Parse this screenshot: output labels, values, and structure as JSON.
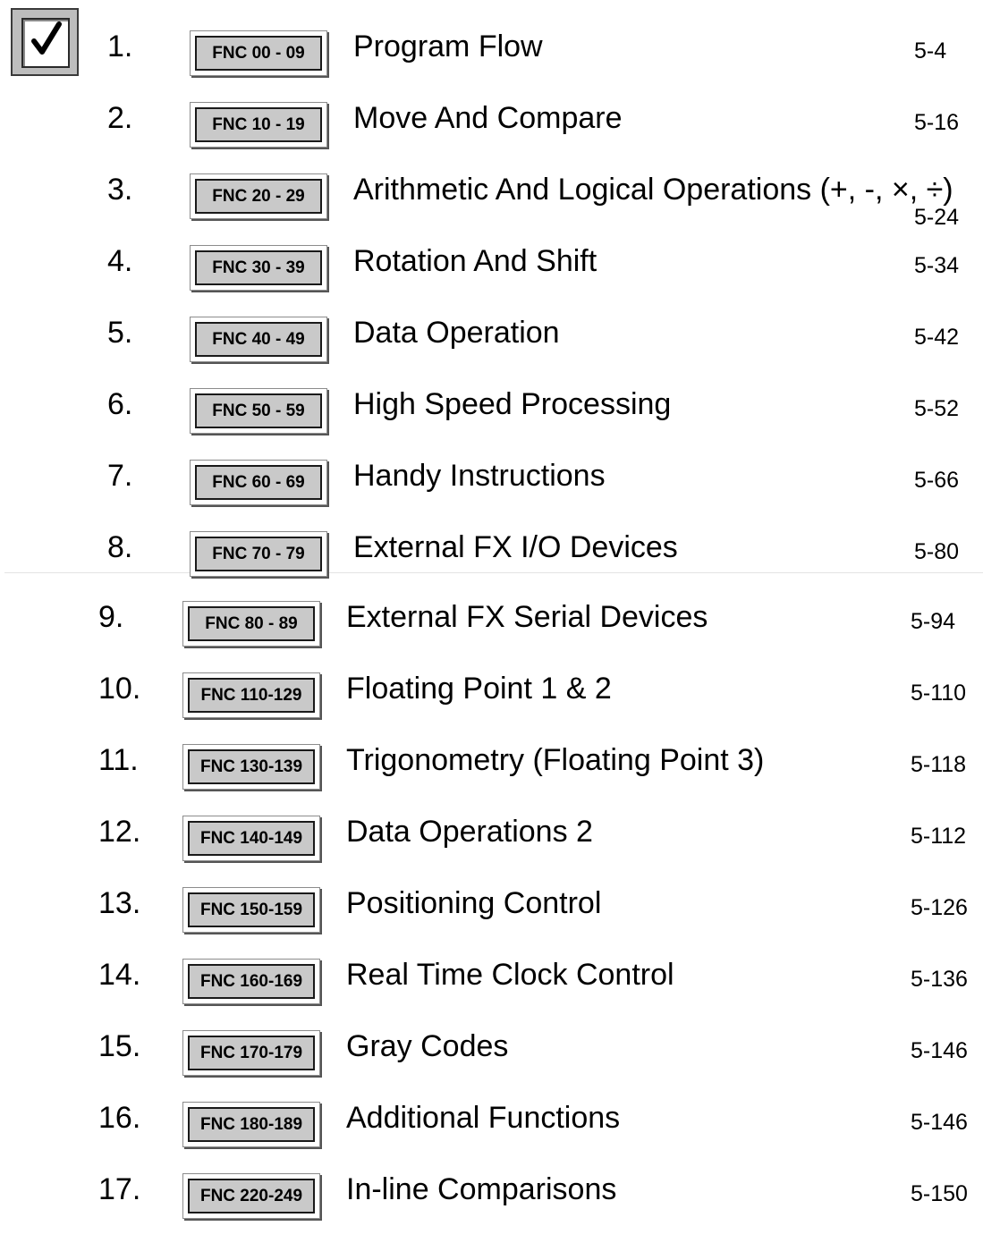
{
  "checkbox": {
    "checked": true,
    "icon": "checkmark-icon"
  },
  "sections": [
    {
      "number": "1.",
      "code": "FNC 00 - 09",
      "title": "Program Flow",
      "page": "5-4"
    },
    {
      "number": "2.",
      "code": "FNC 10 - 19",
      "title": "Move And Compare",
      "page": "5-16"
    },
    {
      "number": "3.",
      "code": "FNC 20 - 29",
      "title": "Arithmetic And Logical Operations (+, -, ×, ÷)",
      "page": "5-24"
    },
    {
      "number": "4.",
      "code": "FNC 30 - 39",
      "title": "Rotation And Shift",
      "page": "5-34"
    },
    {
      "number": "5.",
      "code": "FNC 40 - 49",
      "title": "Data Operation",
      "page": "5-42"
    },
    {
      "number": "6.",
      "code": "FNC 50 - 59",
      "title": "High Speed Processing",
      "page": "5-52"
    },
    {
      "number": "7.",
      "code": "FNC 60 - 69",
      "title": "Handy Instructions",
      "page": "5-66"
    },
    {
      "number": "8.",
      "code": "FNC 70 - 79",
      "title": "External FX I/O Devices",
      "page": "5-80"
    },
    {
      "number": "9.",
      "code": "FNC 80 - 89",
      "title": "External FX Serial Devices",
      "page": "5-94"
    },
    {
      "number": "10.",
      "code": "FNC 110-129",
      "title": "Floating Point 1 & 2",
      "page": "5-110"
    },
    {
      "number": "11.",
      "code": "FNC 130-139",
      "title": "Trigonometry (Floating Point 3)",
      "page": "5-118"
    },
    {
      "number": "12.",
      "code": "FNC 140-149",
      "title": "Data Operations 2",
      "page": "5-112"
    },
    {
      "number": "13.",
      "code": "FNC 150-159",
      "title": "Positioning Control",
      "page": "5-126"
    },
    {
      "number": "14.",
      "code": "FNC 160-169",
      "title": "Real Time Clock Control",
      "page": "5-136"
    },
    {
      "number": "15.",
      "code": "FNC 170-179",
      "title": "Gray Codes",
      "page": "5-146"
    },
    {
      "number": "16.",
      "code": "FNC 180-189",
      "title": "Additional Functions",
      "page": "5-146"
    },
    {
      "number": "17.",
      "code": "FNC 220-249",
      "title": "In-line Comparisons",
      "page": "5-150"
    }
  ]
}
